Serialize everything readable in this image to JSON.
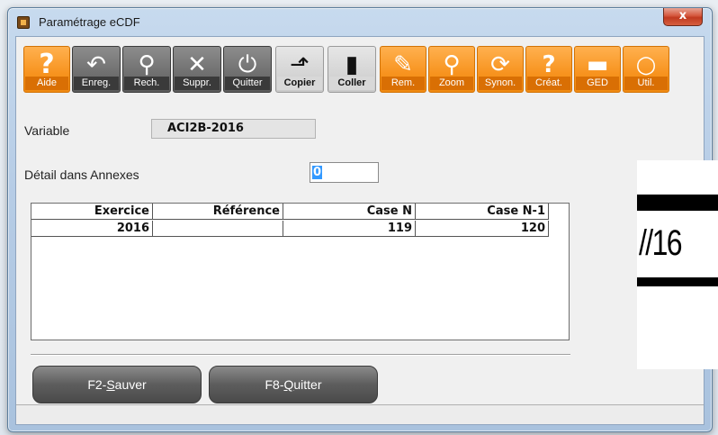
{
  "window": {
    "title": "Paramétrage eCDF",
    "close_glyph": "x"
  },
  "toolbar": {
    "buttons": [
      {
        "label": "Aide",
        "icon": "question-mark-icon",
        "glyph": "?"
      },
      {
        "label": "Enreg.",
        "icon": "undo-arrow-icon",
        "glyph": "↶"
      },
      {
        "label": "Rech.",
        "icon": "search-icon",
        "glyph": "⚲"
      },
      {
        "label": "Suppr.",
        "icon": "delete-x-icon",
        "glyph": "✕"
      },
      {
        "label": "Quitter",
        "icon": "power-icon",
        "glyph": "⏻"
      },
      {
        "label": "Copier",
        "icon": "copy-icon",
        "glyph": "⬏"
      },
      {
        "label": "Coller",
        "icon": "paste-icon",
        "glyph": "▮"
      },
      {
        "label": "Rem.",
        "icon": "pencil-icon",
        "glyph": "✎"
      },
      {
        "label": "Zoom",
        "icon": "zoom-icon",
        "glyph": "⚲"
      },
      {
        "label": "Synon.",
        "icon": "sync-icon",
        "glyph": "⟳"
      },
      {
        "label": "Créat.",
        "icon": "user-create-icon",
        "glyph": "?"
      },
      {
        "label": "GED",
        "icon": "folder-icon",
        "glyph": "▬"
      },
      {
        "label": "Util.",
        "icon": "settings-circles-icon",
        "glyph": "○"
      }
    ]
  },
  "form": {
    "variable_label": "Variable",
    "variable_value": "ACI2B-2016",
    "detail_label": "Détail dans Annexes",
    "detail_value": "0"
  },
  "grid": {
    "columns": [
      "Exercice",
      "Référence",
      "Case N",
      "Case N-1"
    ],
    "rows": [
      [
        "2016",
        "",
        "119",
        "120"
      ]
    ]
  },
  "buttons": {
    "save_prefix": "F2-",
    "save_key": "S",
    "save_rest": "auver",
    "quit_prefix": "F8-",
    "quit_key": "Q",
    "quit_rest": "uitter"
  },
  "overlay": {
    "text": "//16"
  },
  "colors": {
    "accent_orange": "#f7931e",
    "dark_button": "#5c5c5c",
    "selection": "#3399ff",
    "close_red": "#c03a20"
  }
}
